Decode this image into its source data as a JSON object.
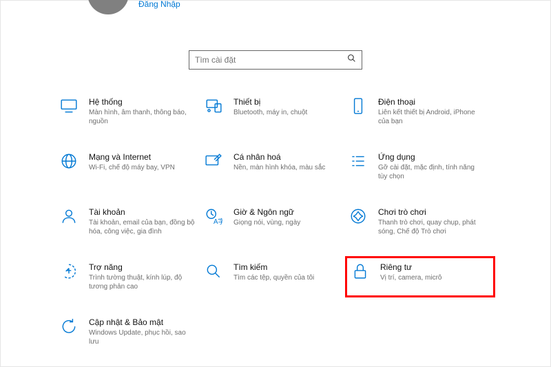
{
  "header": {
    "signin_label": "Đăng Nhập"
  },
  "search": {
    "placeholder": "Tìm cài đặt"
  },
  "tiles": [
    {
      "title": "Hệ thống",
      "desc": "Màn hình, âm thanh, thông báo, nguồn"
    },
    {
      "title": "Thiết bị",
      "desc": "Bluetooth, máy in, chuột"
    },
    {
      "title": "Điện thoại",
      "desc": "Liên kết thiết bị Android, iPhone của bạn"
    },
    {
      "title": "Mạng và Internet",
      "desc": "Wi-Fi, chế độ máy bay, VPN"
    },
    {
      "title": "Cá nhân hoá",
      "desc": "Nền, màn hình khóa, màu sắc"
    },
    {
      "title": "Ứng dụng",
      "desc": "Gỡ cài đặt, mặc định, tính năng tùy chọn"
    },
    {
      "title": "Tài khoản",
      "desc": "Tài khoản, email của bạn, đồng bộ hóa, công việc, gia đình"
    },
    {
      "title": "Giờ & Ngôn ngữ",
      "desc": "Giọng nói, vùng, ngày"
    },
    {
      "title": "Chơi trò chơi",
      "desc": "Thanh trò chơi, quay chụp, phát sóng, Chế độ Trò chơi"
    },
    {
      "title": "Trợ năng",
      "desc": "Trình tường thuật, kính lúp, độ tương phản cao"
    },
    {
      "title": "Tìm kiếm",
      "desc": "Tìm các tệp, quyền của tôi"
    },
    {
      "title": "Riêng tư",
      "desc": "Vị trí, camera, micrô"
    },
    {
      "title": "Cập nhật & Bảo mật",
      "desc": "Windows Update, phục hồi, sao lưu"
    }
  ]
}
